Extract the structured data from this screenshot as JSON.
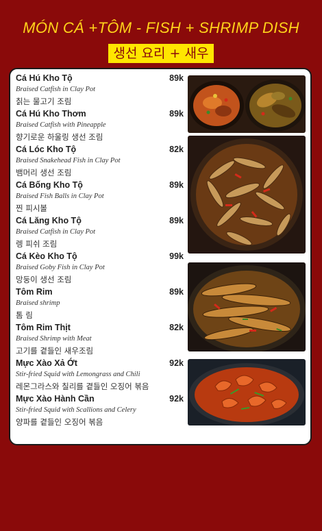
{
  "header": {
    "title": "MÓN CÁ +TÔM - FISH + SHRIMP DISH",
    "subtitle": "생선 요리 + 새우"
  },
  "menu_items": [
    {
      "name": "Cá Hú Kho Tộ",
      "price": "89k",
      "english": "Braised Catfish in Clay Pot",
      "korean": "칡는 물고기 조림"
    },
    {
      "name": "Cá Hú Kho Thơm",
      "price": "89k",
      "english": "Braised Catfish with Pineapple",
      "korean": "향기로운 하울링 생선 조림"
    },
    {
      "name": "Cá Lóc Kho Tộ",
      "price": "82k",
      "english": "Braised Snakehead Fish in Clay Pot",
      "korean": "뱀머리 생선 조림"
    },
    {
      "name": "Cá Bống Kho Tộ",
      "price": "89k",
      "english": "Braised Fish Balls in Clay Pot",
      "korean": "찐 피시볼"
    },
    {
      "name": "Cá Lăng Kho Tộ",
      "price": "89k",
      "english": "Braised Catfish in Clay Pot",
      "korean": "렝 피쉬 조림"
    },
    {
      "name": "Cá Kèo Kho Tộ",
      "price": "99k",
      "english": "Braised Goby Fish in Clay Pot",
      "korean": "망둥이 생선 조림"
    },
    {
      "name": "Tôm Rim",
      "price": "89k",
      "english": "Braised shrimp",
      "korean": "톰 림"
    },
    {
      "name": "Tôm Rim Thịt",
      "price": "82k",
      "english": "Braised Shrimp with Meat",
      "korean": "고기를 곁들인 새우조림"
    },
    {
      "name": "Mực Xào Xả Ớt",
      "price": "92k",
      "english": "Stir-fried Squid with Lemongrass and Chili",
      "korean": "레몬그라스와 칠리를 곁들인 오징어 볶음"
    },
    {
      "name": "Mực Xào Hành Cần",
      "price": "92k",
      "english": "Stir-fried Squid with Scallions and Celery",
      "korean": "양파를 곁들인 오징어 볶음"
    }
  ],
  "colors": {
    "background": "#8a0a0a",
    "title": "#ffd21a",
    "subtitle_bg": "#ffe600",
    "panel": "#ffffff"
  }
}
